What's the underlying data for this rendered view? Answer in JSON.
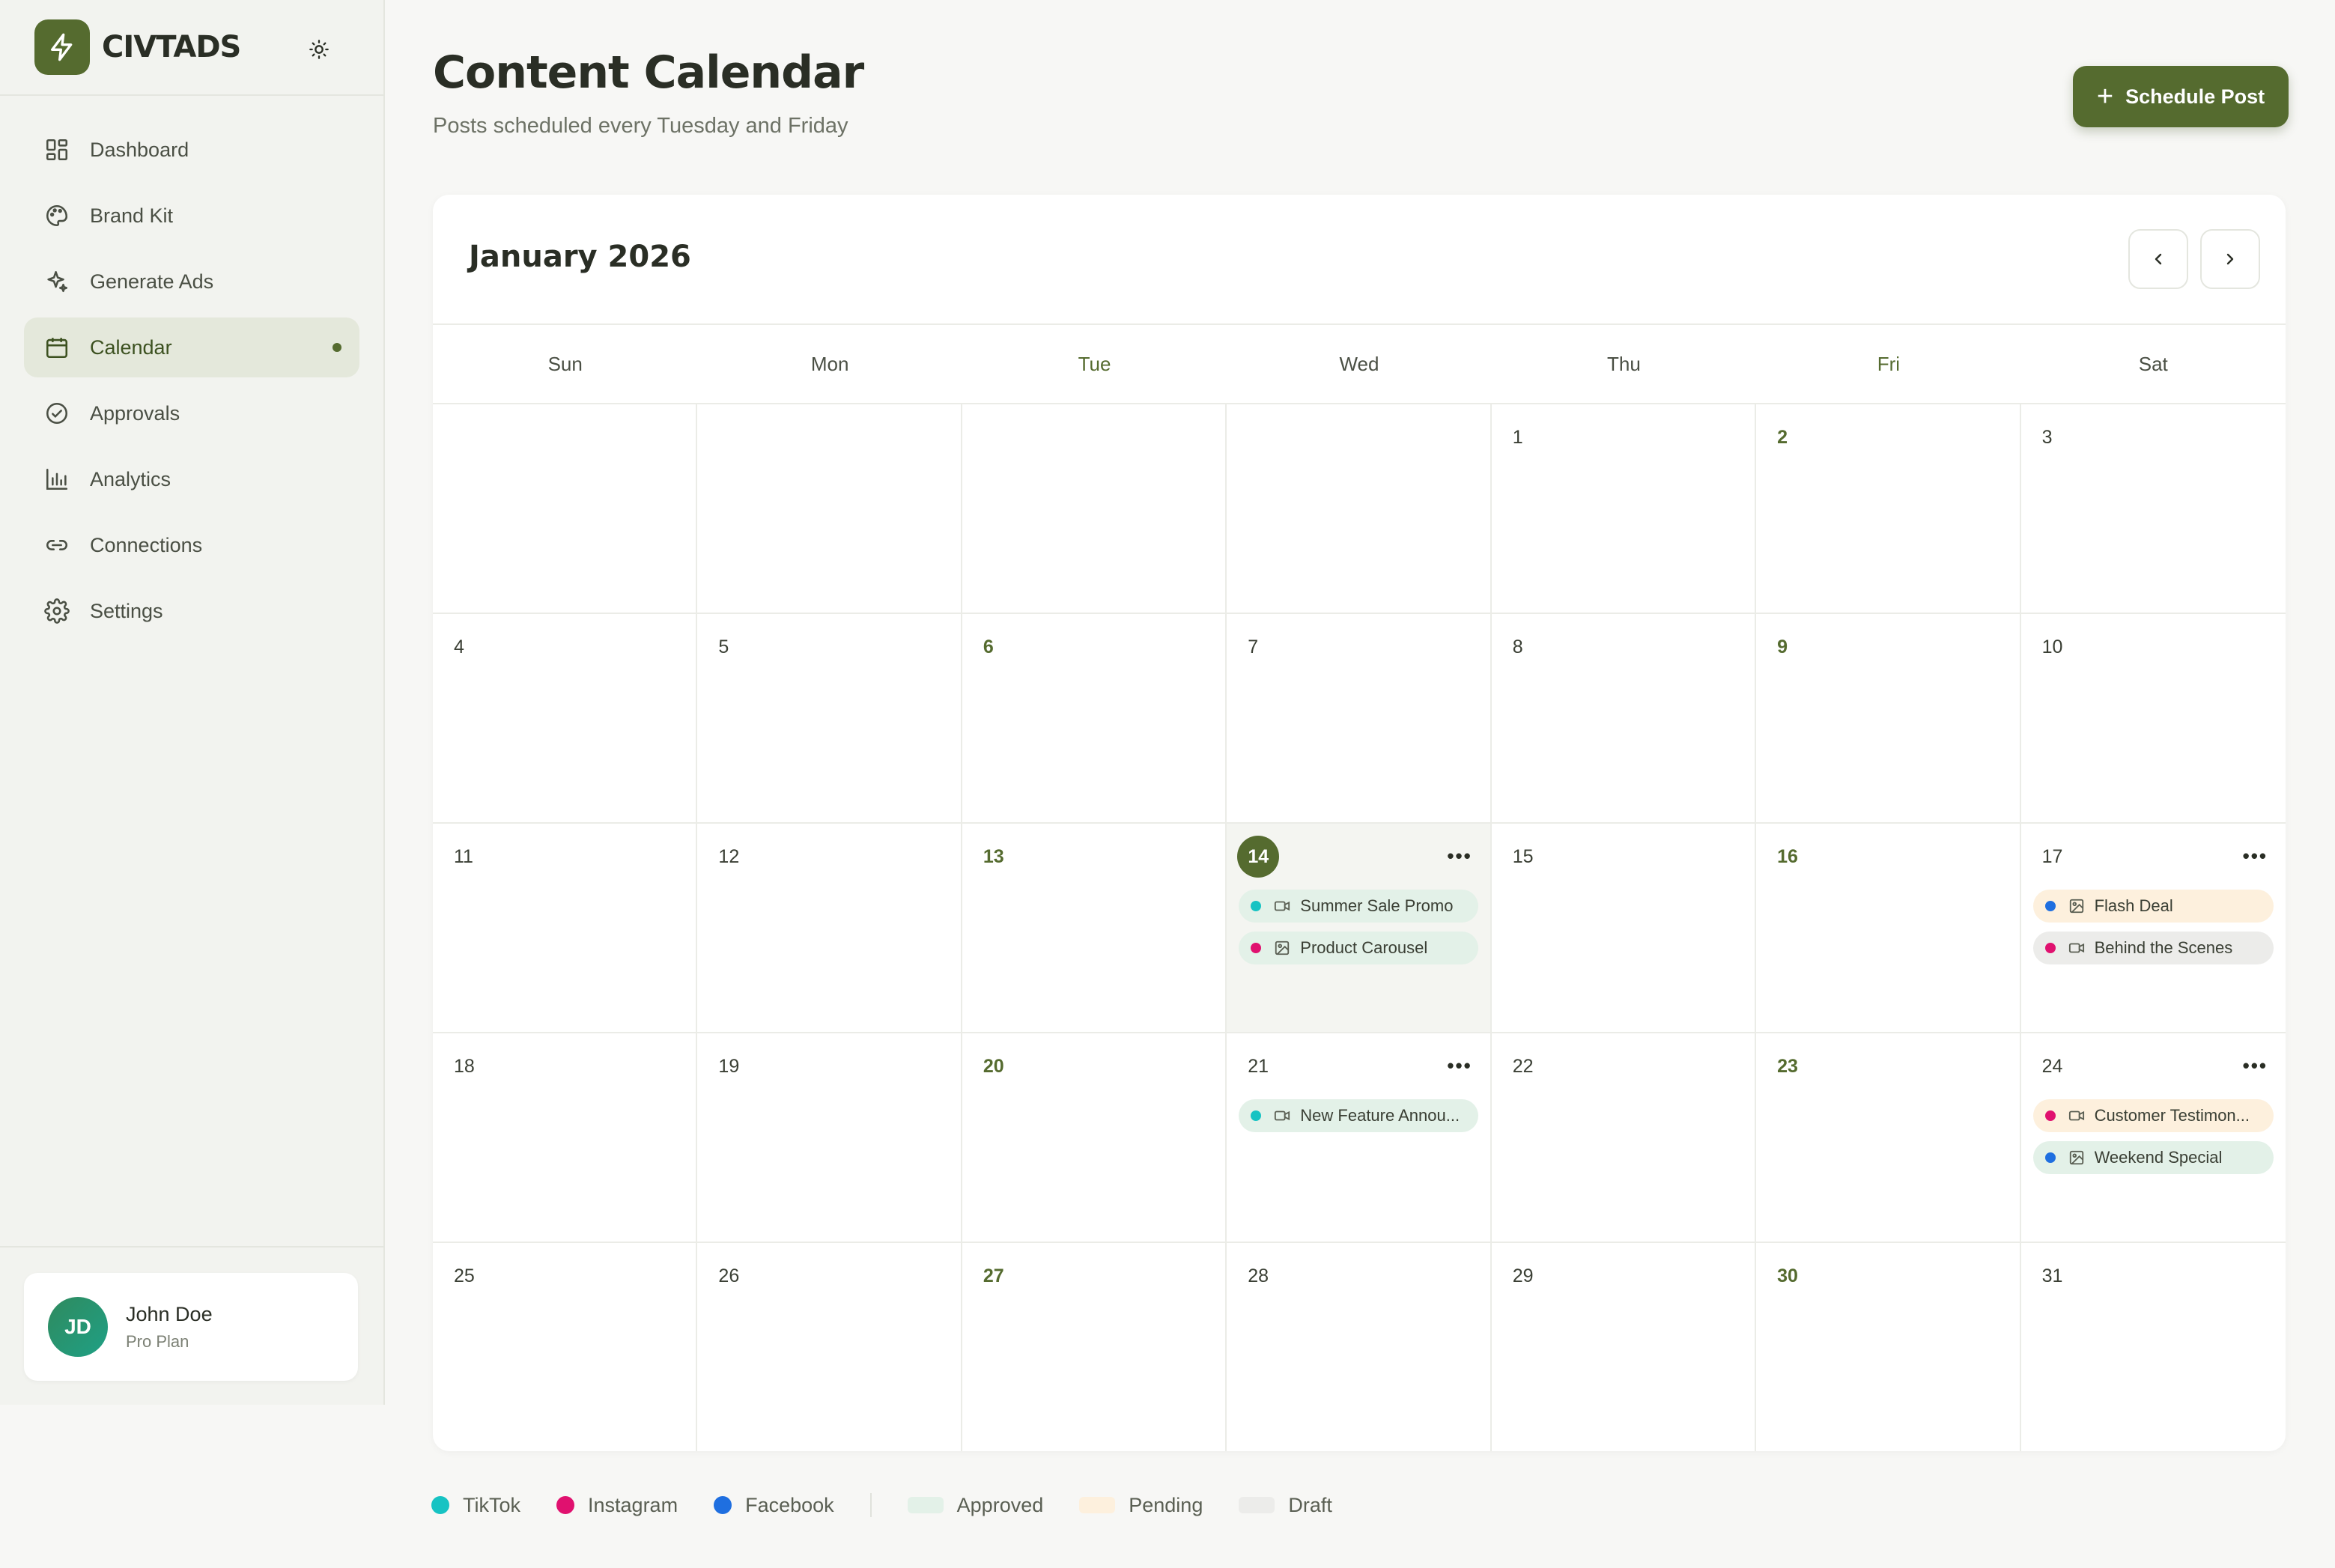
{
  "brand": {
    "name": "CIVTADS"
  },
  "nav": [
    {
      "label": "Dashboard",
      "icon": "grid-icon",
      "active": false
    },
    {
      "label": "Brand Kit",
      "icon": "palette-icon",
      "active": false
    },
    {
      "label": "Generate Ads",
      "icon": "sparkle-icon",
      "active": false
    },
    {
      "label": "Calendar",
      "icon": "calendar-icon",
      "active": true
    },
    {
      "label": "Approvals",
      "icon": "check-circle-icon",
      "active": false
    },
    {
      "label": "Analytics",
      "icon": "bar-chart-icon",
      "active": false
    },
    {
      "label": "Connections",
      "icon": "link-icon",
      "active": false
    },
    {
      "label": "Settings",
      "icon": "gear-icon",
      "active": false
    }
  ],
  "user": {
    "initials": "JD",
    "name": "John Doe",
    "plan": "Pro Plan"
  },
  "header": {
    "title": "Content Calendar",
    "subtitle": "Posts scheduled every Tuesday and Friday",
    "schedule_label": "Schedule Post"
  },
  "calendar": {
    "month": "January 2026",
    "weekdays": [
      "Sun",
      "Mon",
      "Tue",
      "Wed",
      "Thu",
      "Fri",
      "Sat"
    ],
    "publish_weekdays": [
      2,
      5
    ],
    "first_weekday": 4,
    "days_in_month": 31,
    "today": 14,
    "events": {
      "14": [
        {
          "title": "Summer Sale Promo",
          "platform": "tiktok",
          "media": "video",
          "status": "approved"
        },
        {
          "title": "Product Carousel",
          "platform": "instagram",
          "media": "image",
          "status": "approved"
        }
      ],
      "17": [
        {
          "title": "Flash Deal",
          "platform": "facebook",
          "media": "image",
          "status": "pending"
        },
        {
          "title": "Behind the Scenes",
          "platform": "instagram",
          "media": "video",
          "status": "draft"
        }
      ],
      "21": [
        {
          "title": "New Feature Annou...",
          "platform": "tiktok",
          "media": "video",
          "status": "approved"
        }
      ],
      "24": [
        {
          "title": "Customer Testimon...",
          "platform": "instagram",
          "media": "video",
          "status": "pending"
        },
        {
          "title": "Weekend Special",
          "platform": "facebook",
          "media": "image",
          "status": "approved"
        }
      ]
    }
  },
  "legend": {
    "platforms": [
      {
        "label": "TikTok",
        "key": "tiktok"
      },
      {
        "label": "Instagram",
        "key": "instagram"
      },
      {
        "label": "Facebook",
        "key": "facebook"
      }
    ],
    "statuses": [
      {
        "label": "Approved",
        "key": "approved"
      },
      {
        "label": "Pending",
        "key": "pending"
      },
      {
        "label": "Draft",
        "key": "draft"
      }
    ]
  },
  "colors": {
    "accent": "#556b2f",
    "tiktok": "#17c3c3",
    "instagram": "#e0116f",
    "facebook": "#1f6fe0",
    "approved": "#e3f1e8",
    "pending": "#fdf0dd",
    "draft": "#ececea"
  }
}
